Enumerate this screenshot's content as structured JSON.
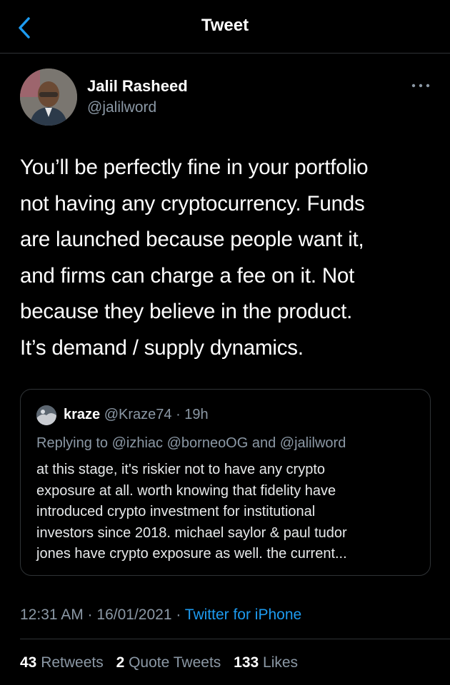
{
  "header": {
    "title": "Tweet",
    "back_icon": "chevron-left-icon",
    "accent_color": "#1d9bf0"
  },
  "author": {
    "name": "Jalil Rasheed",
    "handle": "@jalilword"
  },
  "tweet": {
    "text": "You’ll be perfectly fine in your portfolio\nnot having any cryptocurrency. Funds\nare launched because people want it,\nand firms can charge a fee on it. Not\nbecause they believe in the product.\nIt’s demand / supply dynamics."
  },
  "quote": {
    "name": "kraze",
    "meta": "@Kraze74 · 19h",
    "replying_to": "Replying to @izhiac @borneoOG and @jalilword",
    "text": "at this stage, it's riskier not to have any crypto\nexposure at all. worth knowing that fidelity have\nintroduced crypto investment for institutional\ninvestors since 2018.  michael saylor & paul tudor\njones have crypto exposure as well. the current..."
  },
  "meta": {
    "timestamp": "12:31 AM · 16/01/2021 · ",
    "source": "Twitter for iPhone"
  },
  "stats": {
    "retweets_count": "43",
    "retweets_label": " Retweets",
    "quotes_count": "2",
    "quotes_label": " Quote Tweets",
    "likes_count": "133",
    "likes_label": " Likes"
  }
}
